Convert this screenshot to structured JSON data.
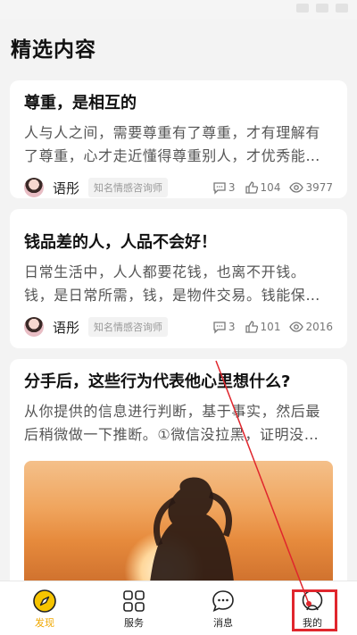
{
  "page": {
    "title": "精选内容"
  },
  "articles": [
    {
      "title": "尊重，是相互的",
      "excerpt": "人与人之间，需要尊重有了尊重，才有理解有了尊重，心才走近懂得尊重别人，才优秀能…",
      "author": "语彤",
      "tag": "知名情感咨询师",
      "comments": "3",
      "likes": "104",
      "views": "3977"
    },
    {
      "title": "钱品差的人，人品不会好！",
      "excerpt": "日常生活中，人人都要花钱，也离不开钱。钱，是日常所需，钱，是物件交易。钱能保…",
      "author": "语彤",
      "tag": "知名情感咨询师",
      "comments": "3",
      "likes": "101",
      "views": "2016"
    },
    {
      "title": "分手后，这些行为代表他心里想什么?",
      "excerpt": "从你提供的信息进行判断，基于事实，然后最后稍微做一下推断。①微信没拉黑，证明没…"
    }
  ],
  "tabbar": {
    "items": [
      {
        "label": "发现",
        "icon": "compass-icon",
        "active": true
      },
      {
        "label": "服务",
        "icon": "grid-icon",
        "active": false
      },
      {
        "label": "消息",
        "icon": "chat-bubble-icon",
        "active": false
      },
      {
        "label": "我的",
        "icon": "profile-icon",
        "active": false
      }
    ]
  },
  "colors": {
    "accent": "#f0a800",
    "annotation": "#e0262d"
  }
}
